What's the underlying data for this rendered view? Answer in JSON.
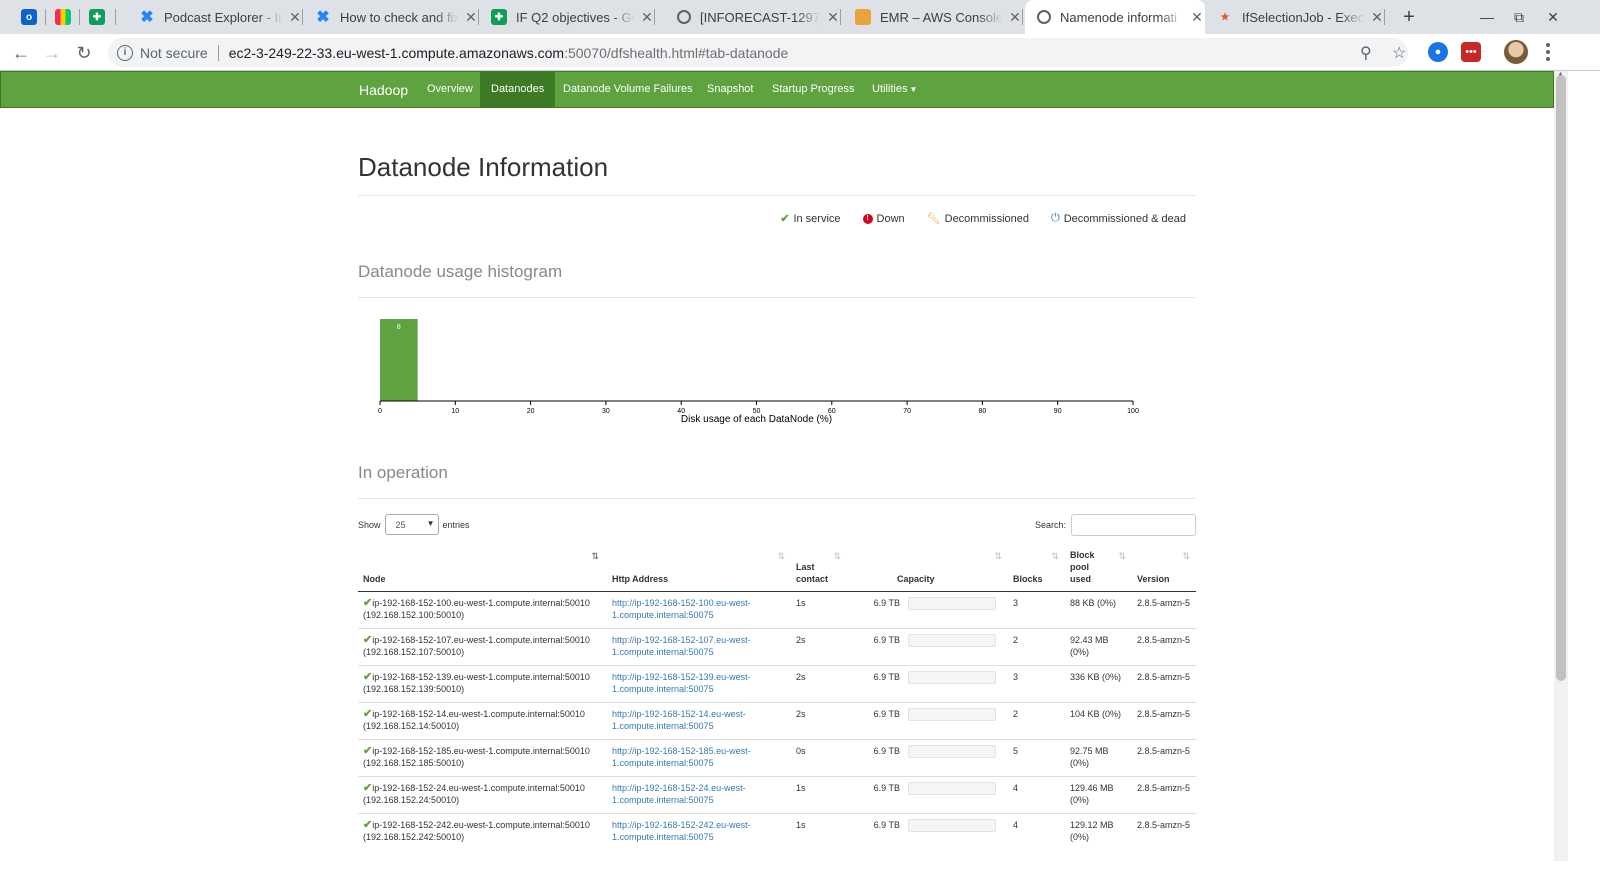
{
  "tabs": [
    {
      "title": "",
      "icon": "outlook-icon",
      "color": "#0a64c9"
    },
    {
      "title": "",
      "icon": "monday-icon",
      "color": "#ffffff"
    },
    {
      "title": "",
      "icon": "sheets-icon",
      "color": "#0f9d58"
    },
    {
      "title": "Podcast Explorer - Ir",
      "icon": "confluence-icon",
      "color": "#2684ff"
    },
    {
      "title": "How to check and fix",
      "icon": "confluence-icon",
      "color": "#2684ff"
    },
    {
      "title": "IF Q2 objectives - Go",
      "icon": "sheets-icon",
      "color": "#0f9d58"
    },
    {
      "title": "[INFORECAST-1297] A",
      "icon": "globe-icon",
      "color": "#5f6368"
    },
    {
      "title": "EMR – AWS Console",
      "icon": "aws-icon",
      "color": "#e8a33a"
    },
    {
      "title": "Namenode informati",
      "icon": "globe-icon",
      "color": "#5f6368"
    },
    {
      "title": "IfSelectionJob - Exec",
      "icon": "spark-icon",
      "color": "#e25a1c"
    }
  ],
  "address": {
    "security": "Not secure",
    "host": "ec2-3-249-22-33.eu-west-1.compute.amazonaws.com",
    "path": ":50070/dfshealth.html#tab-datanode"
  },
  "nav": {
    "brand": "Hadoop",
    "items": [
      "Overview",
      "Datanodes",
      "Datanode Volume Failures",
      "Snapshot",
      "Startup Progress",
      "Utilities"
    ],
    "active": "Datanodes"
  },
  "page": {
    "title": "Datanode Information",
    "legend": [
      "In service",
      "Down",
      "Decommissioned",
      "Decommissioned & dead"
    ],
    "histogram_title": "Datanode usage histogram",
    "in_operation_title": "In operation",
    "show_label": "Show",
    "entries_label": "entries",
    "page_size": "25",
    "search_label": "Search:",
    "search_value": ""
  },
  "chart_data": {
    "type": "bar",
    "x_bins": [
      [
        0,
        5
      ]
    ],
    "values": [
      8
    ],
    "bar_labels": [
      "8"
    ],
    "xlabel": "Disk usage of each DataNode (%)",
    "xlim": [
      0,
      100
    ],
    "x_ticks": [
      0,
      10,
      20,
      30,
      40,
      50,
      60,
      70,
      80,
      90,
      100
    ],
    "color": "#5ea33f"
  },
  "table": {
    "headers": [
      "Node",
      "Http Address",
      "Last contact",
      "Capacity",
      "Blocks",
      "Block pool used",
      "Version"
    ],
    "rows": [
      {
        "node": "ip-192-168-152-100.eu-west-1.compute.internal:50010",
        "ip": "(192.168.152.100:50010)",
        "http1": "http://ip-192-168-152-100.eu-west-",
        "http2": "1.compute.internal:50075",
        "contact": "1s",
        "capacity": "6.9 TB",
        "blocks": "3",
        "used": "88 KB (0%)",
        "version": "2.8.5-amzn-5"
      },
      {
        "node": "ip-192-168-152-107.eu-west-1.compute.internal:50010",
        "ip": "(192.168.152.107:50010)",
        "http1": "http://ip-192-168-152-107.eu-west-",
        "http2": "1.compute.internal:50075",
        "contact": "2s",
        "capacity": "6.9 TB",
        "blocks": "2",
        "used": "92.43 MB (0%)",
        "version": "2.8.5-amzn-5"
      },
      {
        "node": "ip-192-168-152-139.eu-west-1.compute.internal:50010",
        "ip": "(192.168.152.139:50010)",
        "http1": "http://ip-192-168-152-139.eu-west-",
        "http2": "1.compute.internal:50075",
        "contact": "2s",
        "capacity": "6.9 TB",
        "blocks": "3",
        "used": "336 KB (0%)",
        "version": "2.8.5-amzn-5"
      },
      {
        "node": "ip-192-168-152-14.eu-west-1.compute.internal:50010",
        "ip": "(192.168.152.14:50010)",
        "http1": "http://ip-192-168-152-14.eu-west-",
        "http2": "1.compute.internal:50075",
        "contact": "2s",
        "capacity": "6.9 TB",
        "blocks": "2",
        "used": "104 KB (0%)",
        "version": "2.8.5-amzn-5"
      },
      {
        "node": "ip-192-168-152-185.eu-west-1.compute.internal:50010",
        "ip": "(192.168.152.185:50010)",
        "http1": "http://ip-192-168-152-185.eu-west-",
        "http2": "1.compute.internal:50075",
        "contact": "0s",
        "capacity": "6.9 TB",
        "blocks": "5",
        "used": "92.75 MB (0%)",
        "version": "2.8.5-amzn-5"
      },
      {
        "node": "ip-192-168-152-24.eu-west-1.compute.internal:50010",
        "ip": "(192.168.152.24:50010)",
        "http1": "http://ip-192-168-152-24.eu-west-",
        "http2": "1.compute.internal:50075",
        "contact": "1s",
        "capacity": "6.9 TB",
        "blocks": "4",
        "used": "129.46 MB (0%)",
        "version": "2.8.5-amzn-5"
      },
      {
        "node": "ip-192-168-152-242.eu-west-1.compute.internal:50010",
        "ip": "(192.168.152.242:50010)",
        "http1": "http://ip-192-168-152-242.eu-west-",
        "http2": "1.compute.internal:50075",
        "contact": "1s",
        "capacity": "6.9 TB",
        "blocks": "4",
        "used": "129.12 MB (0%)",
        "version": "2.8.5-amzn-5"
      }
    ]
  }
}
